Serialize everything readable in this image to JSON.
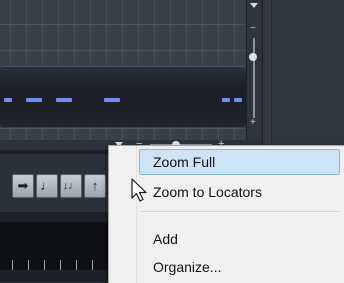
{
  "window": {
    "accent": "#6f8ff1",
    "menu_highlight": "#cde4f7"
  },
  "context_menu": {
    "items": [
      {
        "label": "Zoom Full",
        "highlighted": true
      },
      {
        "label": "Zoom to Locators",
        "highlighted": false
      },
      {
        "label": "Add",
        "highlighted": false
      },
      {
        "label": "Organize...",
        "highlighted": false
      }
    ]
  },
  "zoom_controls": {
    "vertical": {
      "arrow_icon": "triangle-down-icon",
      "minus": "−",
      "plus": "+"
    },
    "horizontal": {
      "arrow_icon": "triangle-down-icon",
      "minus": "−",
      "plus": "+"
    }
  },
  "tools": [
    {
      "icon": "arrow-right-icon",
      "glyph": "➡"
    },
    {
      "icon": "note-icon",
      "glyph": "♩"
    },
    {
      "icon": "note-down-icon",
      "glyph": "↓♩"
    },
    {
      "icon": "note-up-icon",
      "glyph": "↑"
    }
  ],
  "cursor": {
    "icon": "mouse-pointer-icon"
  }
}
